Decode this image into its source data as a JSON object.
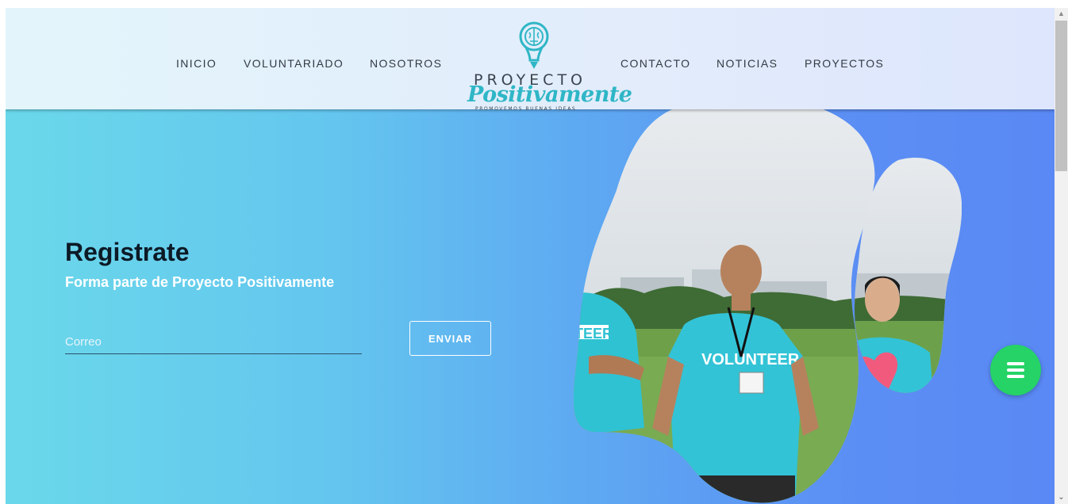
{
  "nav": {
    "left": [
      "INICIO",
      "VOLUNTARIADO",
      "NOSOTROS"
    ],
    "right": [
      "CONTACTO",
      "NOTICIAS",
      "PROYECTOS"
    ]
  },
  "logo": {
    "top": "PROYECTO",
    "script": "Positivamente",
    "tagline": "PROMOVEMOS BUENAS IDEAS",
    "icon": "lightbulb-brain-icon"
  },
  "hero": {
    "title": "Registrate",
    "subtitle": "Forma parte de Proyecto Positivamente",
    "email_placeholder": "Correo",
    "email_value": "",
    "submit_label": "ENVIAR",
    "photo_shirt_text_1": "VOLUNTEER",
    "photo_shirt_text_2": "TEER"
  },
  "fab": {
    "icon": "menu-icon",
    "color": "#25d366"
  },
  "scrollbar": {
    "up_icon": "chevron-up-icon",
    "down_icon": "chevron-down-icon"
  },
  "colors": {
    "accent": "#2fb6c6",
    "hero_start": "#6ad8ea",
    "hero_end": "#5a88f4",
    "title": "#0c1a26"
  }
}
